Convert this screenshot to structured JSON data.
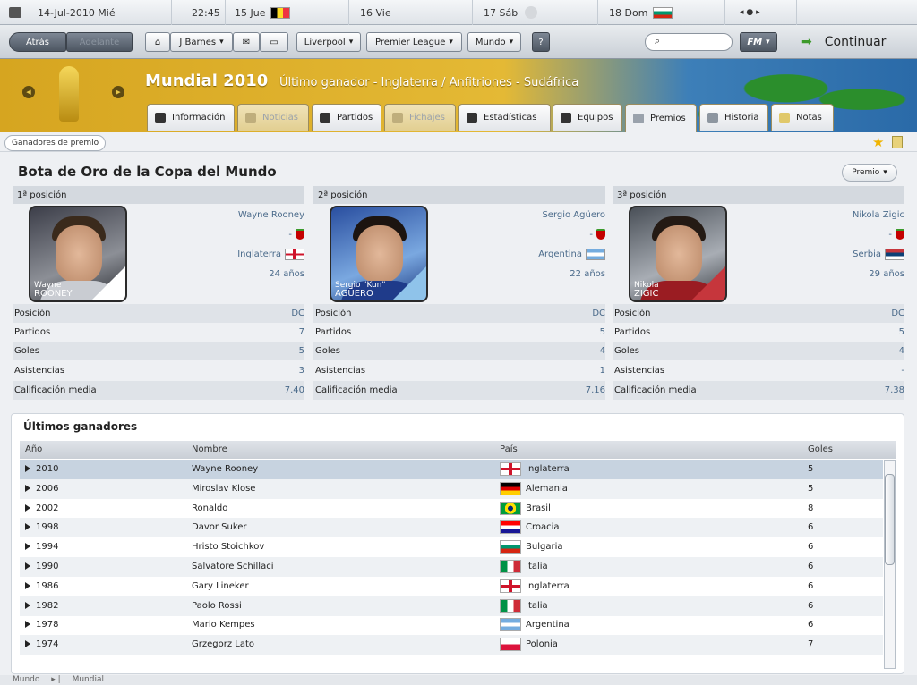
{
  "calendar": {
    "date": "14-Jul-2010 Mié",
    "time": "22:45",
    "days": [
      {
        "label": "15 Jue",
        "flag": "Bélgica"
      },
      {
        "label": "16 Vie",
        "flag": ""
      },
      {
        "label": "17 Sáb",
        "flag": ""
      },
      {
        "label": "18 Dom",
        "flag": "Bulgaria"
      }
    ]
  },
  "nav": {
    "back": "Atrás",
    "forward": "Adelante",
    "manager": "J Barnes",
    "club": "Liverpool",
    "league": "Premier League",
    "world": "Mundo",
    "help": "?",
    "fm": "FM",
    "continue": "Continuar"
  },
  "competition": {
    "title": "Mundial 2010",
    "subtitle": "Último ganador - Inglaterra / Anfitriones - Sudáfrica"
  },
  "tabs": [
    {
      "label": "Información",
      "state": "normal"
    },
    {
      "label": "Noticias",
      "state": "disabled"
    },
    {
      "label": "Partidos",
      "state": "normal"
    },
    {
      "label": "Fichajes",
      "state": "disabled"
    },
    {
      "label": "Estadísticas",
      "state": "normal"
    },
    {
      "label": "Equipos",
      "state": "normal"
    },
    {
      "label": "Premios",
      "state": "active"
    },
    {
      "label": "Historia",
      "state": "normal"
    },
    {
      "label": "Notas",
      "state": "normal"
    }
  ],
  "subbar": {
    "crumb": "Ganadores de premio"
  },
  "award": {
    "title": "Bota de Oro de la Copa del Mundo",
    "menu": "Premio",
    "stat_labels": [
      "Posición",
      "Partidos",
      "Goles",
      "Asistencias",
      "Calificación media"
    ],
    "places": [
      {
        "heading": "1ª posición",
        "name": "Wayne Rooney",
        "club": "-",
        "nation": "Inglaterra",
        "age": "24 años",
        "photo_first": "Wayne",
        "photo_last": "ROONEY",
        "stats": [
          "DC",
          "7",
          "5",
          "3",
          "7.40"
        ]
      },
      {
        "heading": "2ª posición",
        "name": "Sergio Agüero",
        "club": "-",
        "nation": "Argentina",
        "age": "22 años",
        "photo_first": "Sergio \"Kun\"",
        "photo_last": "AGÜERO",
        "stats": [
          "DC",
          "5",
          "4",
          "1",
          "7.16"
        ]
      },
      {
        "heading": "3ª posición",
        "name": "Nikola Zigic",
        "club": "-",
        "nation": "Serbia",
        "age": "29 años",
        "photo_first": "Nikola",
        "photo_last": "ZIGIC",
        "stats": [
          "DC",
          "5",
          "4",
          "-",
          "7.38"
        ]
      }
    ]
  },
  "history": {
    "title": "Últimos ganadores",
    "columns": [
      "Año",
      "Nombre",
      "País",
      "Goles"
    ],
    "rows": [
      {
        "year": "2010",
        "name": "Wayne Rooney",
        "country": "Inglaterra",
        "goals": "5"
      },
      {
        "year": "2006",
        "name": "Miroslav Klose",
        "country": "Alemania",
        "goals": "5"
      },
      {
        "year": "2002",
        "name": "Ronaldo",
        "country": "Brasil",
        "goals": "8"
      },
      {
        "year": "1998",
        "name": "Davor Suker",
        "country": "Croacia",
        "goals": "6"
      },
      {
        "year": "1994",
        "name": "Hristo Stoichkov",
        "country": "Bulgaria",
        "goals": "6"
      },
      {
        "year": "1990",
        "name": "Salvatore Schillaci",
        "country": "Italia",
        "goals": "6"
      },
      {
        "year": "1986",
        "name": "Gary Lineker",
        "country": "Inglaterra",
        "goals": "6"
      },
      {
        "year": "1982",
        "name": "Paolo Rossi",
        "country": "Italia",
        "goals": "6"
      },
      {
        "year": "1978",
        "name": "Mario Kempes",
        "country": "Argentina",
        "goals": "6"
      },
      {
        "year": "1974",
        "name": "Grzegorz Lato",
        "country": "Polonia",
        "goals": "7"
      }
    ]
  },
  "footer": {
    "crumbs": [
      "Mundo",
      "Mundial"
    ]
  },
  "colors": {
    "accent_gold": "#d6a520",
    "ocean": "#2a6aa8",
    "selected_row": "#c7d3e0"
  }
}
